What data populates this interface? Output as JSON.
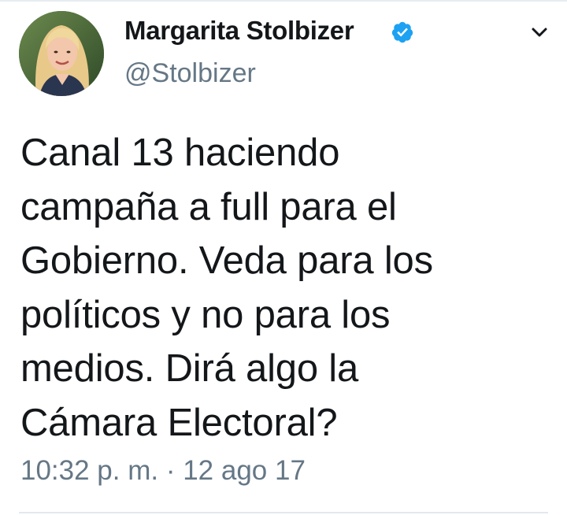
{
  "tweet": {
    "author": {
      "display_name": "Margarita Stolbizer",
      "handle": "@Stolbizer",
      "verified": true,
      "avatar_icon": "profile-photo"
    },
    "text": "Canal 13 haciendo\ncampaña a full para el\nGobierno. Veda para los\npolíticos y no para los\nmedios. Dirá algo la\nCámara Electoral?",
    "timestamp": "10:32 p. m. · 12 ago 17",
    "menu_icon": "chevron-down-icon"
  },
  "colors": {
    "text": "#14171a",
    "secondary": "#657786",
    "verified_badge": "#1da1f2"
  }
}
